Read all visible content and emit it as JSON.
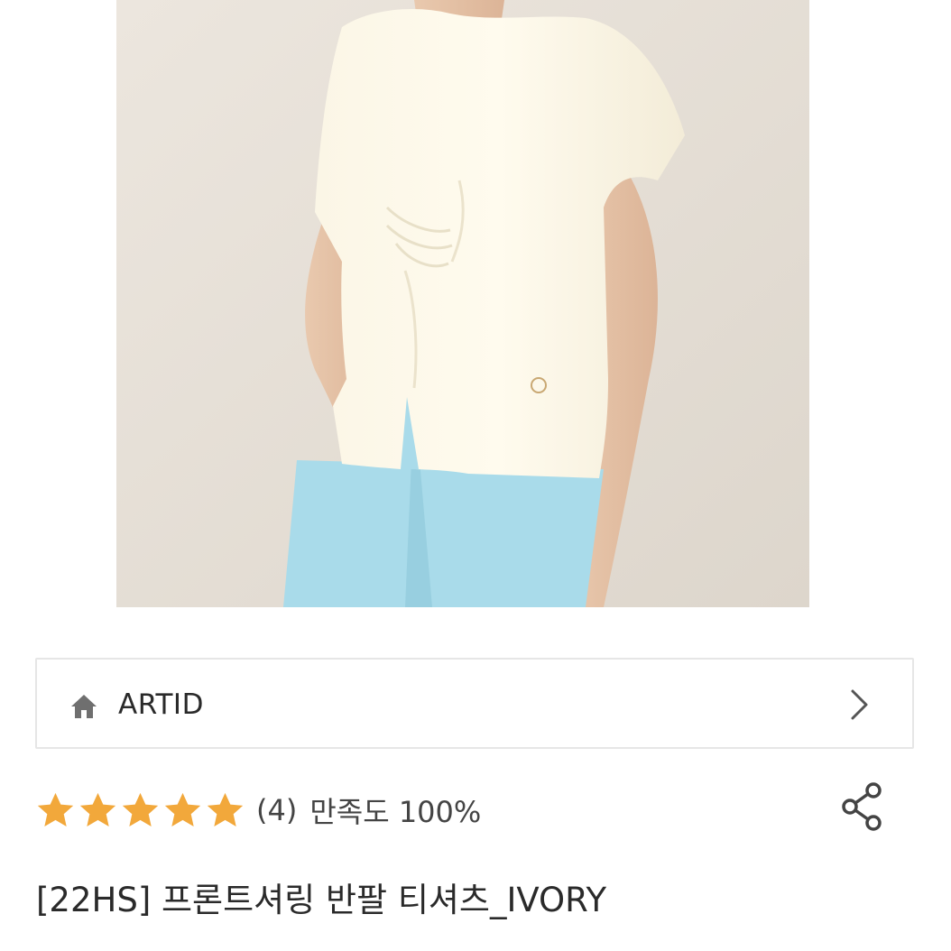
{
  "product_image": {
    "alt": "product photo",
    "icon": "photo"
  },
  "store": {
    "name": "ARTID",
    "icon": "home-icon",
    "action_icon": "chevron-right-icon"
  },
  "rating": {
    "stars": 5,
    "max_stars": 5,
    "star_color": "#f2a83b",
    "review_count": "(4)",
    "satisfaction": "만족도 100%"
  },
  "share": {
    "icon": "share-icon"
  },
  "product": {
    "title": "[22HS] 프론트셔링 반팔 티셔츠_IVORY"
  }
}
